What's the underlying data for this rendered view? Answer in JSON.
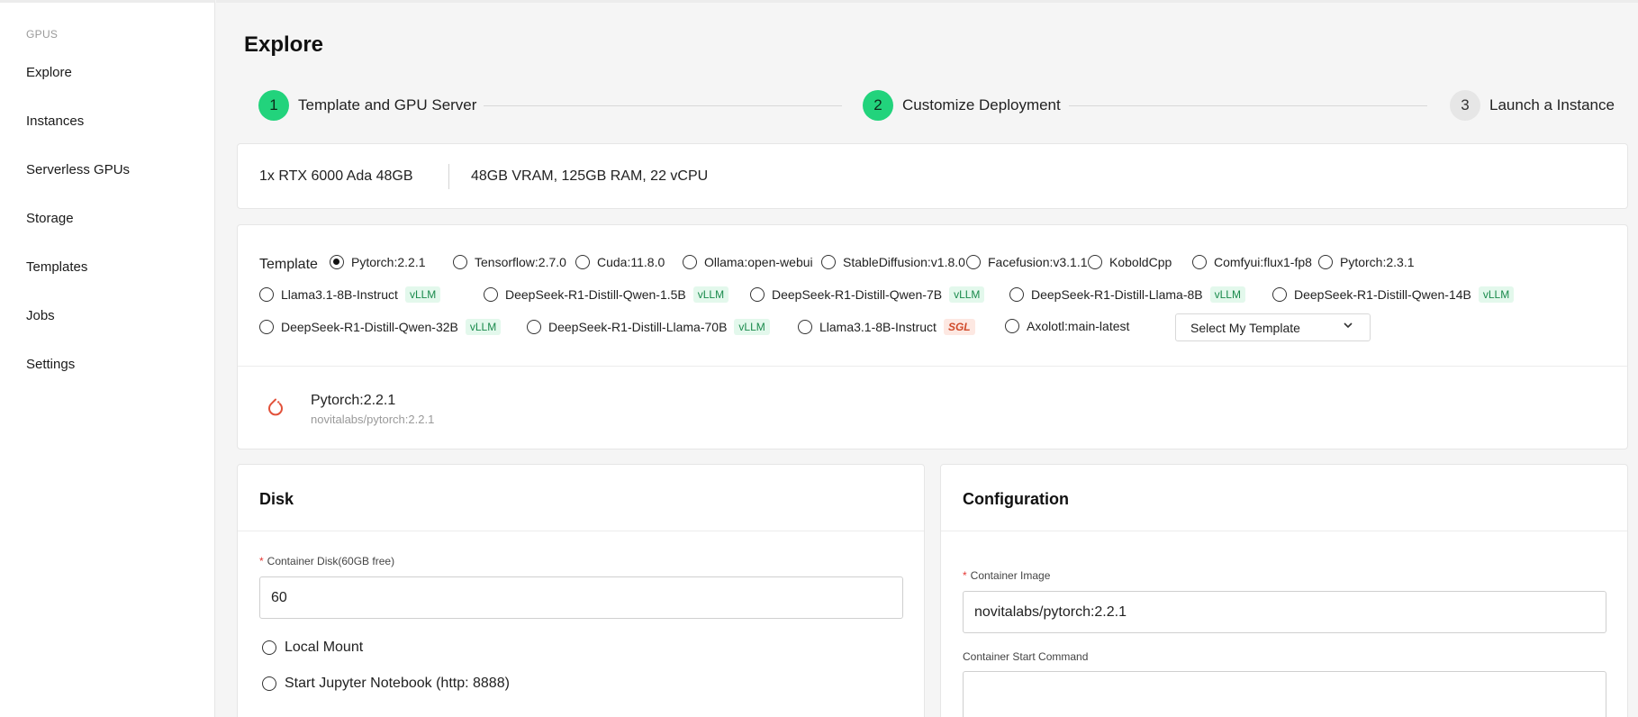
{
  "sidebar": {
    "section": "GPUS",
    "items": [
      "Explore",
      "Instances",
      "Serverless GPUs",
      "Storage",
      "Templates",
      "Jobs",
      "Settings"
    ]
  },
  "page": {
    "title": "Explore"
  },
  "steps": [
    {
      "num": "1",
      "label": "Template and GPU Server",
      "state": "active"
    },
    {
      "num": "2",
      "label": "Customize Deployment",
      "state": "active"
    },
    {
      "num": "3",
      "label": "Launch a Instance",
      "state": "pending"
    }
  ],
  "gpu": {
    "name": "1x RTX 6000 Ada 48GB",
    "specs": "48GB VRAM, 125GB RAM, 22 vCPU"
  },
  "template": {
    "label": "Template",
    "options": [
      {
        "label": "Pytorch:2.2.1",
        "checked": true
      },
      {
        "label": "Tensorflow:2.7.0"
      },
      {
        "label": "Cuda:11.8.0"
      },
      {
        "label": "Ollama:open-webui"
      },
      {
        "label": "StableDiffusion:v1.8.0"
      },
      {
        "label": "Facefusion:v3.1.1"
      },
      {
        "label": "KoboldCpp"
      },
      {
        "label": "Comfyui:flux1-fp8"
      },
      {
        "label": "Pytorch:2.3.1"
      },
      {
        "label": "Llama3.1-8B-Instruct",
        "badge": "vLLM"
      },
      {
        "label": "DeepSeek-R1-Distill-Qwen-1.5B",
        "badge": "vLLM"
      },
      {
        "label": "DeepSeek-R1-Distill-Qwen-7B",
        "badge": "vLLM"
      },
      {
        "label": "DeepSeek-R1-Distill-Llama-8B",
        "badge": "vLLM"
      },
      {
        "label": "DeepSeek-R1-Distill-Qwen-14B",
        "badge": "vLLM"
      },
      {
        "label": "DeepSeek-R1-Distill-Qwen-32B",
        "badge": "vLLM"
      },
      {
        "label": "DeepSeek-R1-Distill-Llama-70B",
        "badge": "vLLM"
      },
      {
        "label": "Llama3.1-8B-Instruct",
        "badge": "SGL"
      },
      {
        "label": "Axolotl:main-latest"
      }
    ],
    "select_label": "Select My Template",
    "selected": {
      "name": "Pytorch:2.2.1",
      "image": "novitalabs/pytorch:2.2.1"
    }
  },
  "disk": {
    "title": "Disk",
    "container_disk_label": "Container Disk(60GB free)",
    "container_disk_value": "60",
    "local_mount": "Local Mount",
    "jupyter": "Start Jupyter Notebook (http: 8888)"
  },
  "config": {
    "title": "Configuration",
    "image_label": "Container Image",
    "image_value": "novitalabs/pytorch:2.2.1",
    "start_cmd_label": "Container Start Command",
    "start_cmd_value": ""
  },
  "colors": {
    "accent": "#22d37c",
    "vllm_bg": "#e3f8ec",
    "vllm_fg": "#1a8a4c",
    "sgl_fg": "#d04a2a",
    "required": "#e53935"
  }
}
